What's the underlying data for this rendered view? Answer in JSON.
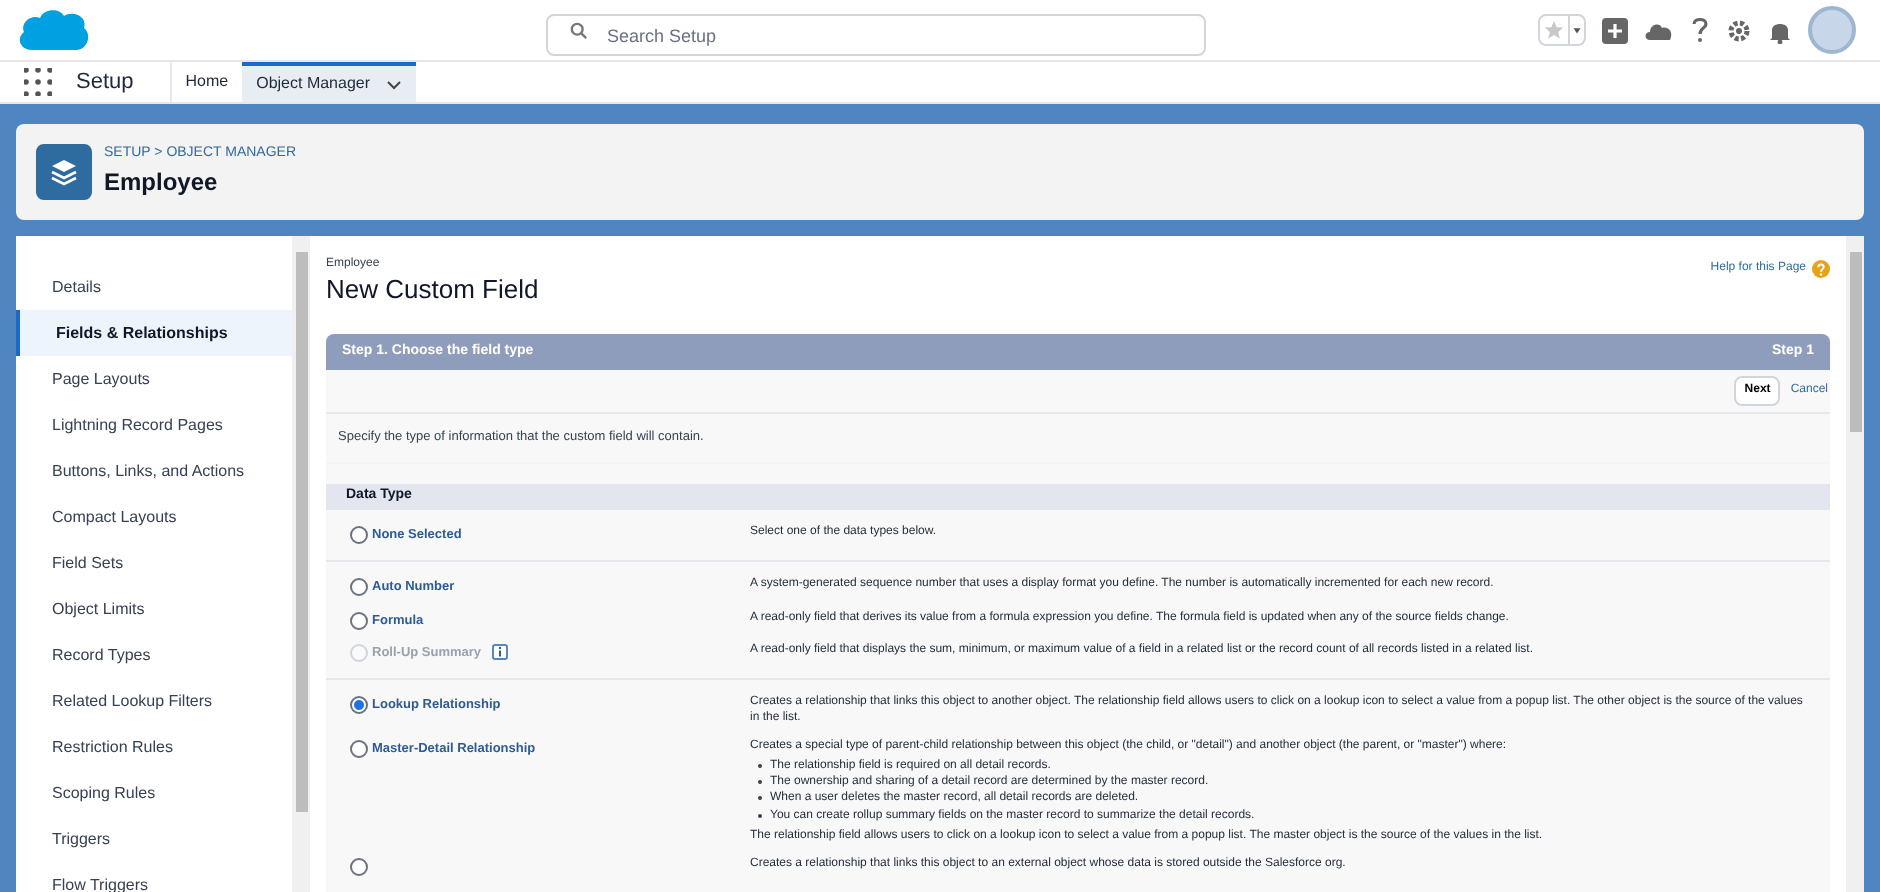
{
  "search": {
    "placeholder": "Search Setup"
  },
  "app": {
    "name": "Setup",
    "tabs": [
      {
        "label": "Home",
        "selected": false,
        "menu": false
      },
      {
        "label": "Object Manager",
        "selected": true,
        "menu": true
      }
    ]
  },
  "header": {
    "breadcrumb": "SETUP > OBJECT MANAGER",
    "title": "Employee"
  },
  "sidebar": {
    "items": [
      {
        "label": "Details",
        "selected": false
      },
      {
        "label": "Fields & Relationships",
        "selected": true
      },
      {
        "label": "Page Layouts",
        "selected": false
      },
      {
        "label": "Lightning Record Pages",
        "selected": false
      },
      {
        "label": "Buttons, Links, and Actions",
        "selected": false
      },
      {
        "label": "Compact Layouts",
        "selected": false
      },
      {
        "label": "Field Sets",
        "selected": false
      },
      {
        "label": "Object Limits",
        "selected": false
      },
      {
        "label": "Record Types",
        "selected": false
      },
      {
        "label": "Related Lookup Filters",
        "selected": false
      },
      {
        "label": "Restriction Rules",
        "selected": false
      },
      {
        "label": "Scoping Rules",
        "selected": false
      },
      {
        "label": "Triggers",
        "selected": false
      },
      {
        "label": "Flow Triggers",
        "selected": false
      }
    ]
  },
  "page": {
    "object": "Employee",
    "title": "New Custom Field",
    "help": "Help for this Page",
    "step_title": "Step 1. Choose the field type",
    "step_label": "Step 1",
    "buttons": [
      {
        "label": "Next",
        "kind": "button"
      },
      {
        "label": "Cancel",
        "kind": "link"
      }
    ],
    "intro": "Specify the type of information that the custom field will contain.",
    "section": "Data Type"
  },
  "groups": [
    {
      "rows": [
        {
          "label": "None Selected",
          "selected": false,
          "disabled": false,
          "info": false,
          "description": "Select one of the data types below."
        }
      ]
    },
    {
      "rows": [
        {
          "label": "Auto Number",
          "selected": false,
          "disabled": false,
          "info": false,
          "description": "A system-generated sequence number that uses a display format you define. The number is automatically incremented for each new record."
        },
        {
          "label": "Formula",
          "selected": false,
          "disabled": false,
          "info": false,
          "description": "A read-only field that derives its value from a formula expression you define. The formula field is updated when any of the source fields change."
        },
        {
          "label": "Roll-Up Summary",
          "selected": false,
          "disabled": true,
          "info": true,
          "description": "A read-only field that displays the sum, minimum, or maximum value of a field in a related list or the record count of all records listed in a related list."
        }
      ]
    },
    {
      "rows": [
        {
          "label": "Lookup Relationship",
          "selected": true,
          "disabled": false,
          "info": false,
          "description": "Creates a relationship that links this object to another object. The relationship field allows users to click on a lookup icon to select a value from a popup list. The other object is the source of the values in the list."
        },
        {
          "label": "Master-Detail Relationship",
          "selected": false,
          "disabled": false,
          "info": false,
          "description": "Creates a special type of parent-child relationship between this object (the child, or \"detail\") and another object (the parent, or \"master\") where:",
          "bullets": [
            "The relationship field is required on all detail records.",
            "The ownership and sharing of a detail record are determined by the master record.",
            "When a user deletes the master record, all detail records are deleted.",
            "You can create rollup summary fields on the master record to summarize the detail records."
          ],
          "note": "The relationship field allows users to click on a lookup icon to select a value from a popup list. The master object is the source of the values in the list."
        },
        {
          "label": "",
          "selected": false,
          "disabled": false,
          "info": false,
          "description": "Creates a relationship that links this object to an external object whose data is stored outside the Salesforce org."
        }
      ]
    }
  ]
}
